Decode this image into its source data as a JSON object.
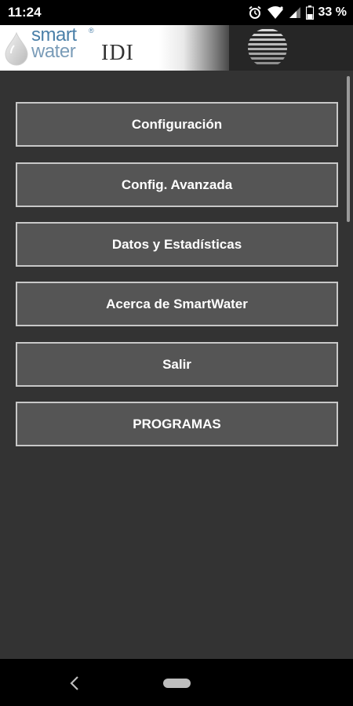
{
  "status_bar": {
    "time": "11:24",
    "battery_text": "33 %",
    "icons": [
      "alarm-icon",
      "wifi-icon",
      "signal-icon",
      "battery-icon"
    ]
  },
  "header": {
    "logo_smart": "smart",
    "logo_water": "water",
    "logo_reg": "®",
    "logo_idi": "IDI"
  },
  "menu": {
    "items": [
      {
        "label": "Configuración"
      },
      {
        "label": "Config. Avanzada"
      },
      {
        "label": "Datos y Estadísticas"
      },
      {
        "label": "Acerca de SmartWater"
      },
      {
        "label": "Salir"
      },
      {
        "label": "PROGRAMAS"
      }
    ]
  },
  "nav_bar": {
    "icons": [
      "back-icon",
      "home-pill-icon"
    ]
  },
  "colors": {
    "content_bg": "#333333",
    "button_bg": "#555555",
    "button_border": "#c8c8c8",
    "logo_blue": "#4a7fa8"
  }
}
